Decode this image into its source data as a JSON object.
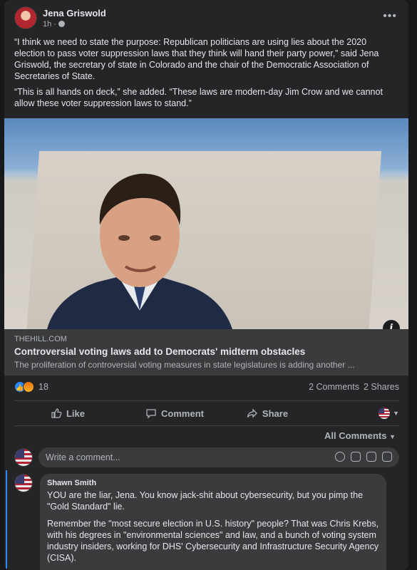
{
  "post": {
    "author": "Jena Griswold",
    "time": "1h",
    "paragraphs": [
      "“I think we need to state the purpose: Republican politicians are using lies about the 2020 election to pass voter suppression laws that they think will hand their party power,” said Jena Griswold, the secretary of state in Colorado and the chair of the Democratic Association of Secretaries of State.",
      "“This is all hands on deck,” she added. “These laws are modern-day Jim Crow and we cannot allow these voter suppression laws to stand.”"
    ]
  },
  "link": {
    "domain": "THEHILL.COM",
    "title": "Controversial voting laws add to Democrats' midterm obstacles",
    "description": "The proliferation of controversial voting measures in state legislatures is adding another ..."
  },
  "stats": {
    "reaction_count": "18",
    "comments": "2 Comments",
    "shares": "2 Shares"
  },
  "actions": {
    "like": "Like",
    "comment": "Comment",
    "share": "Share"
  },
  "comments_filter": "All Comments",
  "compose": {
    "placeholder": "Write a comment..."
  },
  "comment": {
    "author": "Shawn Smith",
    "paragraphs": [
      "YOU are the liar, Jena. You know jack-shit about cybersecurity, but you pimp the \"Gold Standard\" lie.",
      "Remember the \"most secure election in U.S. history\" people? That was Chris Krebs, with his degrees in \"environmental sciences\" and law, and a bunch of voting system industry insiders, working for DHS' Cybersecurity and Infrastructure Security Agency (CISA)."
    ]
  },
  "colors": {
    "background": "#18191a",
    "card": "#242526",
    "accent": "#2d88ff"
  }
}
